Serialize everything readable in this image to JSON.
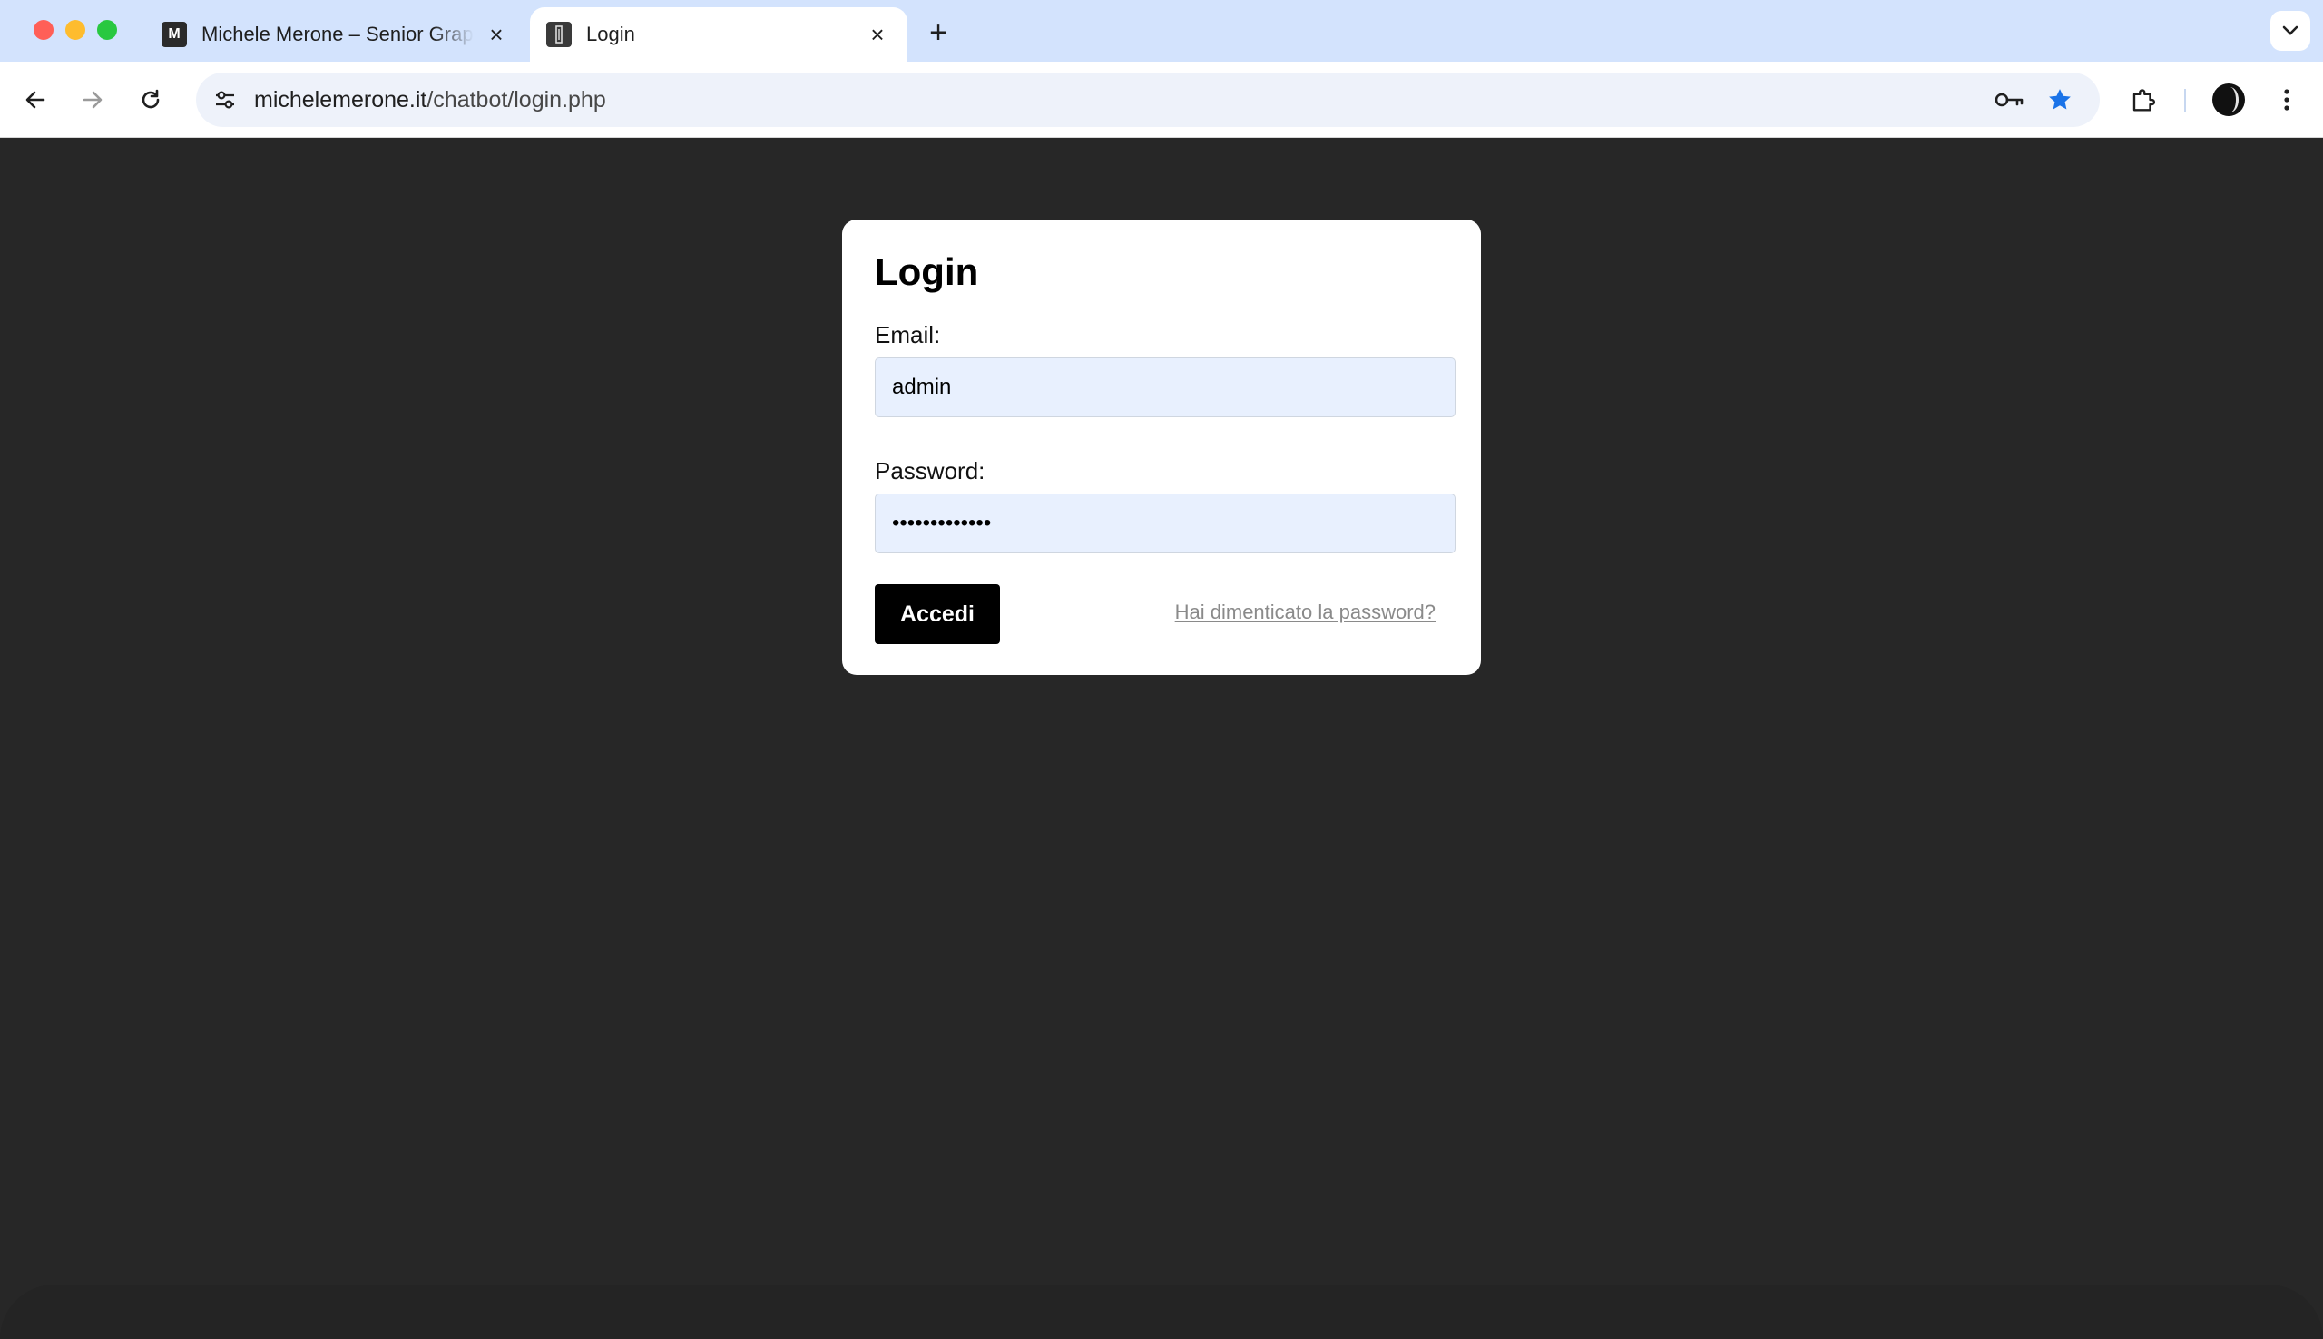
{
  "browser": {
    "tabs": [
      {
        "title": "Michele Merone – Senior Graphic Designer",
        "favicon": "M",
        "active": false
      },
      {
        "title": "Login",
        "favicon": "chatbot-favicon",
        "active": true
      }
    ],
    "address_bar": {
      "domain": "michelemerone.it",
      "path": "/chatbot/login.php"
    },
    "accent_color": "#1a73e8"
  },
  "login": {
    "title": "Login",
    "email_label": "Email:",
    "email_value": "admin",
    "password_label": "Password:",
    "password_value": "•••••••••••••",
    "submit_label": "Accedi",
    "forgot_link": "Hai dimenticato la password?"
  }
}
